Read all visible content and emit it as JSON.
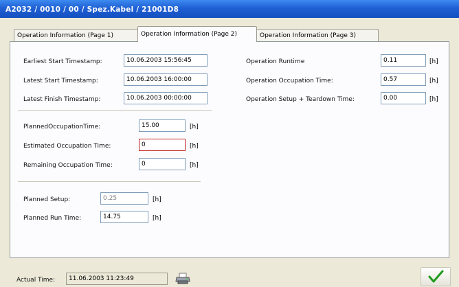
{
  "window": {
    "title": "A2032 / 0010 / 00 / Spez.Kabel / 21001D8"
  },
  "tabs": [
    {
      "label": "Operation Information (Page 1)"
    },
    {
      "label": "Operation Information (Page 2)"
    },
    {
      "label": "Operation Information (Page 3)"
    }
  ],
  "timestamps": {
    "earliest_start": {
      "label": "Earliest Start Timestamp:",
      "value": "10.06.2003 15:56:45"
    },
    "latest_start": {
      "label": "Latest Start Timestamp:",
      "value": "10.06.2003 16:00:00"
    },
    "latest_finish": {
      "label": "Latest Finish Timestamp:",
      "value": "10.06.2003 00:00:00"
    }
  },
  "operation": {
    "runtime": {
      "label": "Operation Runtime",
      "value": "0.11",
      "unit": "[h]"
    },
    "occupation_time": {
      "label": "Operation Occupation Time:",
      "value": "0.57",
      "unit": "[h]"
    },
    "setup_teardown": {
      "label": "Operation Setup + Teardown Time:",
      "value": "0.00",
      "unit": "[h]"
    }
  },
  "occupation": {
    "planned": {
      "label": "PlannedOccupationTime:",
      "value": "15.00",
      "unit": "[h]"
    },
    "estimated": {
      "label": "Estimated Occupation Time:",
      "value": "0",
      "unit": "[h]"
    },
    "remaining": {
      "label": "Remaining Occupation Time:",
      "value": "0",
      "unit": "[h]"
    }
  },
  "setup": {
    "planned_setup": {
      "label": "Planned Setup:",
      "value": "0.25",
      "unit": "[h]"
    },
    "planned_run": {
      "label": "Planned Run Time:",
      "value": "14.75",
      "unit": "[h]"
    }
  },
  "status": {
    "actual_time_label": "Actual Time:",
    "actual_time_value": "11.06.2003 11:23:49"
  },
  "icons": {
    "print": "printer-icon",
    "ok": "checkmark-icon"
  },
  "colors": {
    "titlebar": "#1f60d4",
    "field_border": "#7f9db9",
    "error_border": "#c0201c",
    "ok_check": "#1e9a1e"
  }
}
